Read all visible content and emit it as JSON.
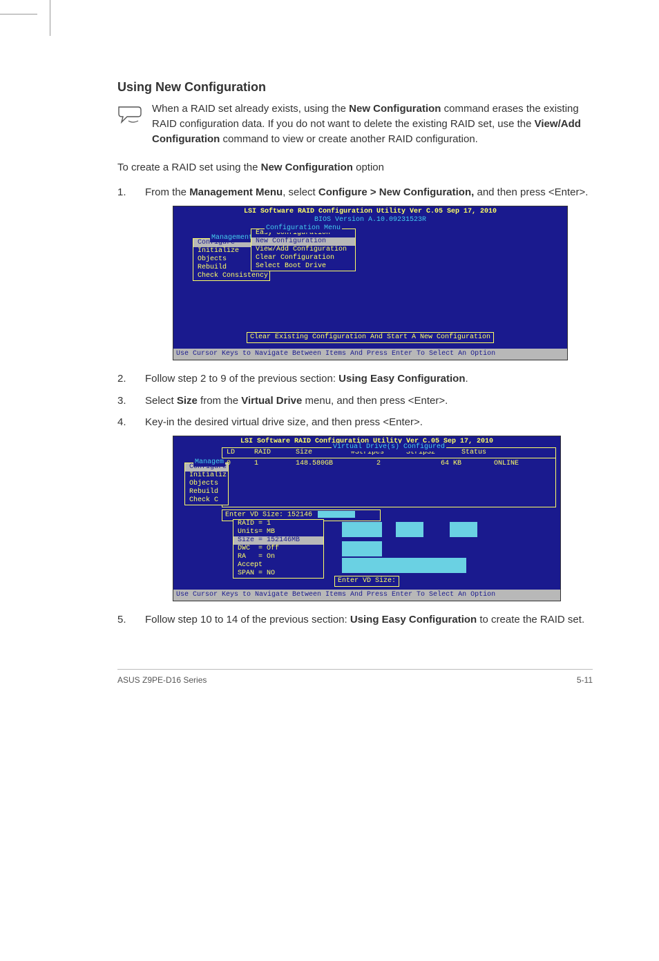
{
  "headings": {
    "using_new_configuration": "Using New Configuration"
  },
  "note": {
    "p1a": "When a RAID set already exists, using the ",
    "p1b": "New Configuration",
    "p1c": " command erases the existing RAID configuration data. If you do not want to delete the existing RAID set, use the ",
    "p1d": "View/Add Configuration",
    "p1e": " command to view or create another RAID configuration."
  },
  "intro": {
    "a": "To create a RAID set using the ",
    "b": "New Configuration",
    "c": " option"
  },
  "steps": {
    "s1a": "From the ",
    "s1b": "Management Menu",
    "s1c": ", select ",
    "s1d": "Configure > New Configuration,",
    "s1e": " and then press <Enter>.",
    "s2a": "Follow step 2 to 9 of the previous section: ",
    "s2b": "Using Easy Configuration",
    "s2c": ".",
    "s3a": "Select ",
    "s3b": "Size",
    "s3c": " from the ",
    "s3d": "Virtual Drive",
    "s3e": " menu, and then press <Enter>.",
    "s4": "Key-in the desired virtual drive size, and then press <Enter>.",
    "s5a": "Follow step 10 to 14 of the previous section: ",
    "s5b": "Using Easy Configuration",
    "s5c": " to create the RAID set."
  },
  "bios": {
    "title": "LSI Software RAID Configuration Utility Ver C.05 Sep 17, 2010",
    "version_label": "BIOS Version   A.10.09231523R",
    "mgmt_menu_title": "Management Menu",
    "mgmt_items": [
      "Configure",
      "Initialize",
      "Objects",
      "Rebuild",
      "Check Consistency"
    ],
    "mgmt_label": "Management",
    "cfg_menu_title": "Configuration Menu",
    "cfg_items": [
      "Easy Configuration",
      "New Configuration",
      "View/Add Configuration",
      "Clear Configuration",
      "Select Boot Drive"
    ],
    "hint1": "Clear Existing Configuration And Start A New Configuration",
    "footer": "Use Cursor Keys to Navigate Between Items And Press Enter To Select An Option"
  },
  "bios2": {
    "vd_configured_title": "Virtual Drive(s) Configured",
    "headers": [
      "LD",
      "RAID",
      "Size",
      "#Stripes",
      "StripSz",
      "Status"
    ],
    "row": [
      "0",
      "1",
      "148.580GB",
      "2",
      "64 KB",
      "ONLINE"
    ],
    "mgmt_items_short": [
      "Configure",
      "Initializ",
      "Objects",
      "Rebuild",
      "Check C"
    ],
    "mgmt_label_short": "Managem",
    "enter_vd": "Enter VD Size: 152146",
    "props": [
      "RAID = 1",
      "Units= MB",
      "Size = 152146MB",
      "DWC  = Off",
      "RA   = On",
      "Accept",
      "SPAN = NO"
    ],
    "hint2": "Enter VD Size:"
  },
  "footer": {
    "product": "ASUS Z9PE-D16 Series",
    "page": "5-11"
  }
}
